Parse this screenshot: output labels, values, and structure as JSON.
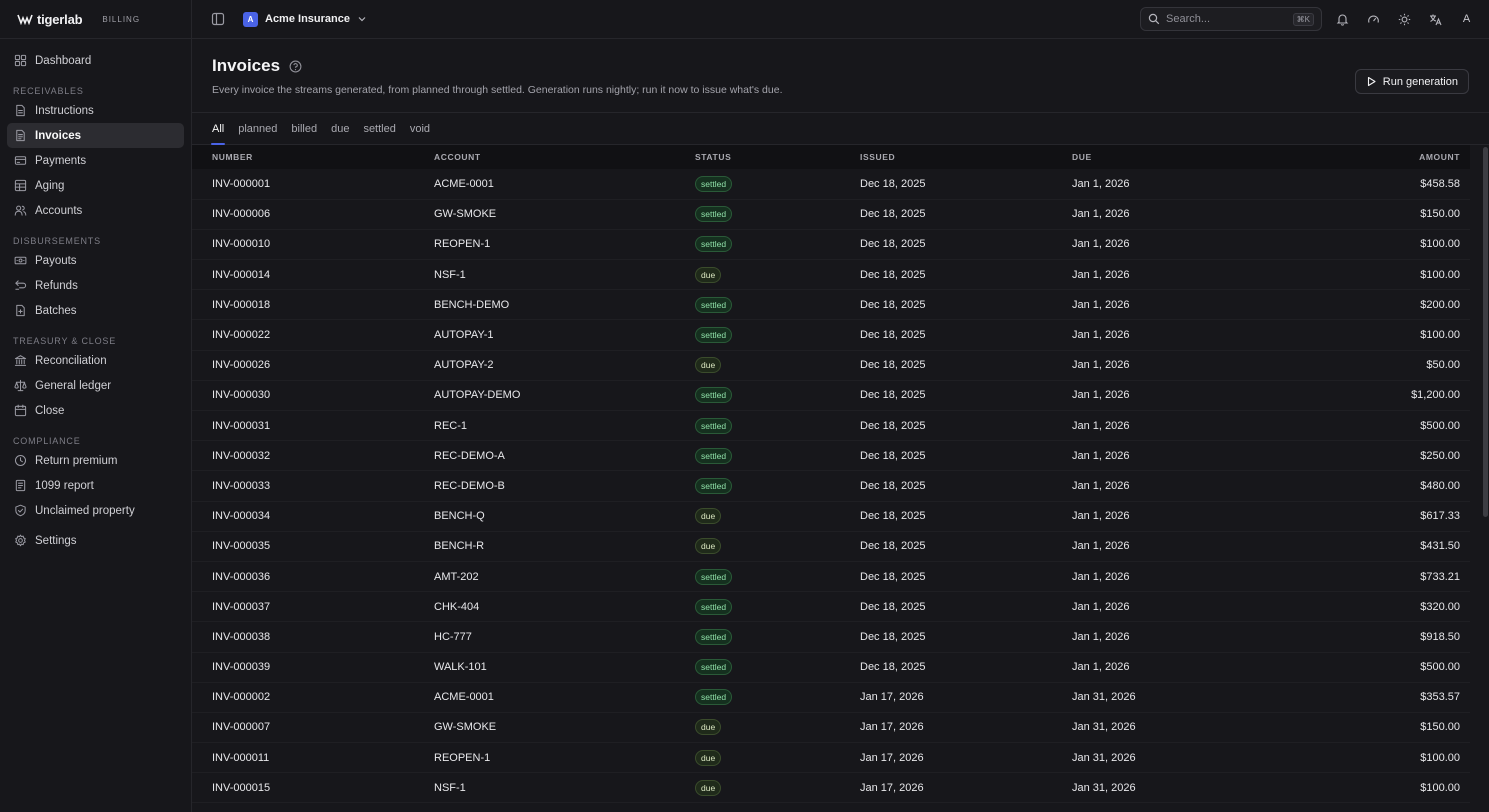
{
  "brand": {
    "name": "tigerlab",
    "product": "BILLING"
  },
  "sidebar": {
    "top": [
      {
        "label": "Dashboard",
        "icon": "dashboard-icon"
      }
    ],
    "sections": [
      {
        "title": "RECEIVABLES",
        "items": [
          {
            "label": "Instructions",
            "icon": "document-icon"
          },
          {
            "label": "Invoices",
            "icon": "invoice-icon",
            "active": true
          },
          {
            "label": "Payments",
            "icon": "payment-icon"
          },
          {
            "label": "Aging",
            "icon": "table-icon"
          },
          {
            "label": "Accounts",
            "icon": "users-icon"
          }
        ]
      },
      {
        "title": "DISBURSEMENTS",
        "items": [
          {
            "label": "Payouts",
            "icon": "banknote-icon"
          },
          {
            "label": "Refunds",
            "icon": "refund-icon"
          },
          {
            "label": "Batches",
            "icon": "batch-icon"
          }
        ]
      },
      {
        "title": "TREASURY & CLOSE",
        "items": [
          {
            "label": "Reconciliation",
            "icon": "bank-icon"
          },
          {
            "label": "General ledger",
            "icon": "scale-icon"
          },
          {
            "label": "Close",
            "icon": "calendar-icon"
          }
        ]
      },
      {
        "title": "COMPLIANCE",
        "items": [
          {
            "label": "Return premium",
            "icon": "clock-icon"
          },
          {
            "label": "1099 report",
            "icon": "report-icon"
          },
          {
            "label": "Unclaimed property",
            "icon": "shield-icon"
          }
        ]
      }
    ],
    "bottom": [
      {
        "label": "Settings",
        "icon": "gear-icon"
      }
    ]
  },
  "topbar": {
    "org_initial": "A",
    "org_name": "Acme Insurance",
    "search_placeholder": "Search...",
    "search_shortcut": "⌘K",
    "user_initial": "A"
  },
  "header": {
    "title": "Invoices",
    "subtitle": "Every invoice the streams generated, from planned through settled. Generation runs nightly; run it now to issue what's due.",
    "run_button": "Run generation"
  },
  "tabs": [
    {
      "label": "All",
      "active": true
    },
    {
      "label": "planned"
    },
    {
      "label": "billed"
    },
    {
      "label": "due"
    },
    {
      "label": "settled"
    },
    {
      "label": "void"
    }
  ],
  "table": {
    "columns": [
      "NUMBER",
      "ACCOUNT",
      "STATUS",
      "ISSUED",
      "DUE",
      "AMOUNT"
    ],
    "rows": [
      [
        "INV-000001",
        "ACME-0001",
        "settled",
        "Dec 18, 2025",
        "Jan 1, 2026",
        "$458.58"
      ],
      [
        "INV-000006",
        "GW-SMOKE",
        "settled",
        "Dec 18, 2025",
        "Jan 1, 2026",
        "$150.00"
      ],
      [
        "INV-000010",
        "REOPEN-1",
        "settled",
        "Dec 18, 2025",
        "Jan 1, 2026",
        "$100.00"
      ],
      [
        "INV-000014",
        "NSF-1",
        "due",
        "Dec 18, 2025",
        "Jan 1, 2026",
        "$100.00"
      ],
      [
        "INV-000018",
        "BENCH-DEMO",
        "settled",
        "Dec 18, 2025",
        "Jan 1, 2026",
        "$200.00"
      ],
      [
        "INV-000022",
        "AUTOPAY-1",
        "settled",
        "Dec 18, 2025",
        "Jan 1, 2026",
        "$100.00"
      ],
      [
        "INV-000026",
        "AUTOPAY-2",
        "due",
        "Dec 18, 2025",
        "Jan 1, 2026",
        "$50.00"
      ],
      [
        "INV-000030",
        "AUTOPAY-DEMO",
        "settled",
        "Dec 18, 2025",
        "Jan 1, 2026",
        "$1,200.00"
      ],
      [
        "INV-000031",
        "REC-1",
        "settled",
        "Dec 18, 2025",
        "Jan 1, 2026",
        "$500.00"
      ],
      [
        "INV-000032",
        "REC-DEMO-A",
        "settled",
        "Dec 18, 2025",
        "Jan 1, 2026",
        "$250.00"
      ],
      [
        "INV-000033",
        "REC-DEMO-B",
        "settled",
        "Dec 18, 2025",
        "Jan 1, 2026",
        "$480.00"
      ],
      [
        "INV-000034",
        "BENCH-Q",
        "due",
        "Dec 18, 2025",
        "Jan 1, 2026",
        "$617.33"
      ],
      [
        "INV-000035",
        "BENCH-R",
        "due",
        "Dec 18, 2025",
        "Jan 1, 2026",
        "$431.50"
      ],
      [
        "INV-000036",
        "AMT-202",
        "settled",
        "Dec 18, 2025",
        "Jan 1, 2026",
        "$733.21"
      ],
      [
        "INV-000037",
        "CHK-404",
        "settled",
        "Dec 18, 2025",
        "Jan 1, 2026",
        "$320.00"
      ],
      [
        "INV-000038",
        "HC-777",
        "settled",
        "Dec 18, 2025",
        "Jan 1, 2026",
        "$918.50"
      ],
      [
        "INV-000039",
        "WALK-101",
        "settled",
        "Dec 18, 2025",
        "Jan 1, 2026",
        "$500.00"
      ],
      [
        "INV-000002",
        "ACME-0001",
        "settled",
        "Jan 17, 2026",
        "Jan 31, 2026",
        "$353.57"
      ],
      [
        "INV-000007",
        "GW-SMOKE",
        "due",
        "Jan 17, 2026",
        "Jan 31, 2026",
        "$150.00"
      ],
      [
        "INV-000011",
        "REOPEN-1",
        "due",
        "Jan 17, 2026",
        "Jan 31, 2026",
        "$100.00"
      ],
      [
        "INV-000015",
        "NSF-1",
        "due",
        "Jan 17, 2026",
        "Jan 31, 2026",
        "$100.00"
      ]
    ]
  }
}
